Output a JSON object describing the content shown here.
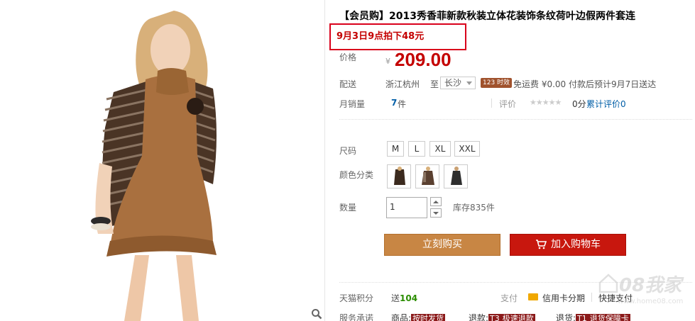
{
  "product": {
    "title": "【会员购】2013秀香菲新款秋装立体花装饰条纹荷叶边假两件套连",
    "promo": "9月3日9点拍下48元"
  },
  "price": {
    "label": "价格",
    "currency": "¥",
    "value": "209.00"
  },
  "shipping": {
    "label": "配送",
    "from": "浙江杭州",
    "to_label": "至",
    "to_city": "长沙",
    "timely_badge": "123 时效",
    "fee_text": "免运费 ¥0.00 付款后预计9月7日送达"
  },
  "sales": {
    "label": "月销量",
    "count": "7",
    "unit": "件",
    "review_label": "评价",
    "stars": "★★★★★",
    "review_score": "0分",
    "review_link": "累计评价0"
  },
  "options": {
    "size_label": "尺码",
    "sizes": [
      "M",
      "L",
      "XL",
      "XXL"
    ],
    "color_label": "颜色分类",
    "quantity_label": "数量",
    "quantity_value": "1",
    "stock": "库存835件"
  },
  "actions": {
    "buy_now": "立刻购买",
    "add_to_cart": "加入购物车"
  },
  "points": {
    "label": "天猫积分",
    "send": "送",
    "amount": "104",
    "pay_label": "支付",
    "pay_card": "信用卡分期",
    "pay_fast": "快捷支付"
  },
  "service": {
    "label": "服务承诺",
    "goods_prefix": "商品:",
    "goods_tag": "按时发货",
    "refund_prefix": "退款:",
    "refund_code": "T3",
    "refund_tag": "极速退款",
    "return_prefix": "退货:",
    "return_code": "T1",
    "return_tag": "退货保障卡"
  },
  "watermark": {
    "brand": "08我家",
    "site": "www.home08.com"
  },
  "colors": {
    "price_red": "#c40000",
    "buy_orange": "#c88644",
    "cart_red": "#c8170e",
    "link_blue": "#005ea7"
  }
}
